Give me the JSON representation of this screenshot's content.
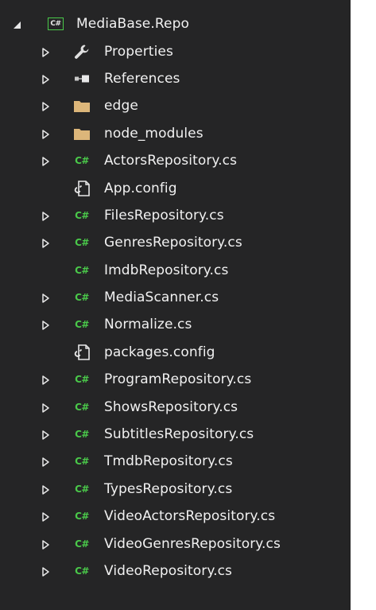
{
  "project": {
    "name": "MediaBase.Repo",
    "icon": "csharp-project-icon",
    "icon_glyph": "C#",
    "expanded": true
  },
  "colors": {
    "panel_bg": "#252526",
    "text": "#f1f1f1",
    "csharp_green": "#4ac94a",
    "folder_yellow": "#dcb67a",
    "arrow": "#e8e8e8"
  },
  "items": [
    {
      "label": "Properties",
      "icon": "wrench-icon",
      "expandable": true
    },
    {
      "label": "References",
      "icon": "references-icon",
      "expandable": true
    },
    {
      "label": "edge",
      "icon": "folder-icon",
      "expandable": true
    },
    {
      "label": "node_modules",
      "icon": "folder-icon",
      "expandable": true
    },
    {
      "label": "ActorsRepository.cs",
      "icon": "csharp-file-icon",
      "expandable": true
    },
    {
      "label": "App.config",
      "icon": "config-file-icon",
      "expandable": false
    },
    {
      "label": "FilesRepository.cs",
      "icon": "csharp-file-icon",
      "expandable": true
    },
    {
      "label": "GenresRepository.cs",
      "icon": "csharp-file-icon",
      "expandable": true
    },
    {
      "label": "ImdbRepository.cs",
      "icon": "csharp-file-icon",
      "expandable": false
    },
    {
      "label": "MediaScanner.cs",
      "icon": "csharp-file-icon",
      "expandable": true
    },
    {
      "label": "Normalize.cs",
      "icon": "csharp-file-icon",
      "expandable": true
    },
    {
      "label": "packages.config",
      "icon": "config-file-icon",
      "expandable": false
    },
    {
      "label": "ProgramRepository.cs",
      "icon": "csharp-file-icon",
      "expandable": true
    },
    {
      "label": "ShowsRepository.cs",
      "icon": "csharp-file-icon",
      "expandable": true
    },
    {
      "label": "SubtitlesRepository.cs",
      "icon": "csharp-file-icon",
      "expandable": true
    },
    {
      "label": "TmdbRepository.cs",
      "icon": "csharp-file-icon",
      "expandable": true
    },
    {
      "label": "TypesRepository.cs",
      "icon": "csharp-file-icon",
      "expandable": true
    },
    {
      "label": "VideoActorsRepository.cs",
      "icon": "csharp-file-icon",
      "expandable": true
    },
    {
      "label": "VideoGenresRepository.cs",
      "icon": "csharp-file-icon",
      "expandable": true
    },
    {
      "label": "VideoRepository.cs",
      "icon": "csharp-file-icon",
      "expandable": true
    }
  ]
}
